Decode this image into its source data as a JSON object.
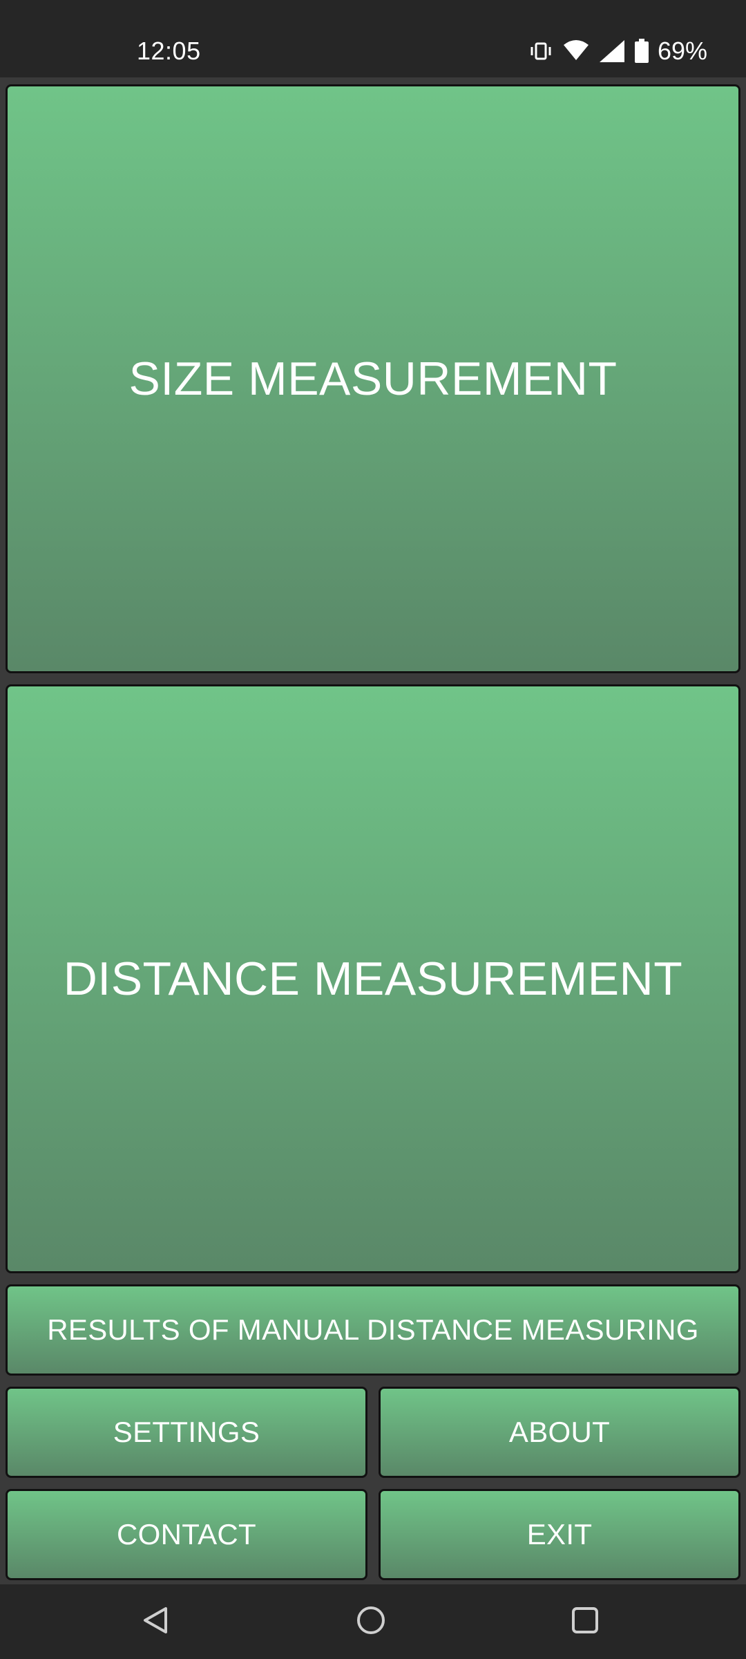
{
  "status_bar": {
    "time": "12:05",
    "battery_percent": "69%",
    "icons": [
      "vibrate-icon",
      "wifi-icon",
      "cellular-signal-icon",
      "battery-icon"
    ]
  },
  "main": {
    "size_measurement_label": "SIZE MEASUREMENT",
    "distance_measurement_label": "DISTANCE MEASUREMENT",
    "results_label": "RESULTS OF MANUAL DISTANCE MEASURING",
    "settings_label": "SETTINGS",
    "about_label": "ABOUT",
    "contact_label": "CONTACT",
    "exit_label": "EXIT"
  },
  "nav_bar": {
    "icons": [
      "back-icon",
      "home-icon",
      "recents-icon"
    ]
  },
  "colors": {
    "button_top": "#70c488",
    "button_bottom": "#5a8868",
    "background": "#3a3a3a",
    "system_bars": "#262626"
  }
}
